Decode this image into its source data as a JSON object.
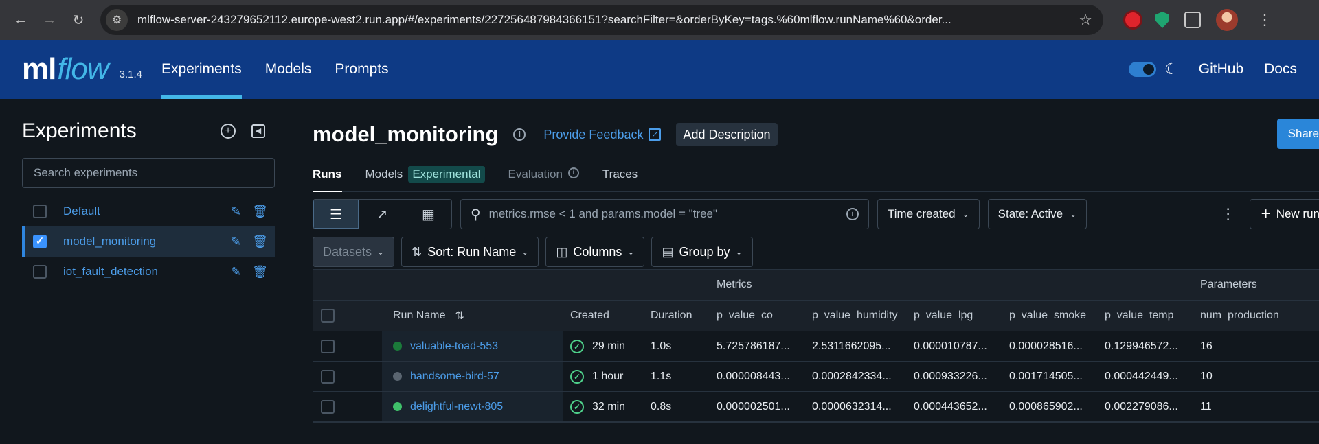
{
  "browser": {
    "url": "mlflow-server-243279652112.europe-west2.run.app/#/experiments/227256487984366151?searchFilter=&orderByKey=tags.%60mlflow.runName%60&order..."
  },
  "header": {
    "logo_ml": "ml",
    "logo_flow": "flow",
    "version": "3.1.4",
    "nav": [
      "Experiments",
      "Models",
      "Prompts"
    ],
    "links": [
      "GitHub",
      "Docs"
    ],
    "accent": "#43b7e8",
    "bg": "#0e3a85"
  },
  "sidebar": {
    "title": "Experiments",
    "search_placeholder": "Search experiments",
    "items": [
      {
        "name": "Default",
        "selected": false
      },
      {
        "name": "model_monitoring",
        "selected": true
      },
      {
        "name": "iot_fault_detection",
        "selected": false
      }
    ]
  },
  "main": {
    "title": "model_monitoring",
    "feedback": "Provide Feedback",
    "add_description": "Add Description",
    "share": "Share",
    "tabs": [
      {
        "label": "Runs"
      },
      {
        "label": "Models",
        "badge": "Experimental"
      },
      {
        "label": "Evaluation"
      },
      {
        "label": "Traces"
      }
    ],
    "filter_placeholder": "metrics.rmse < 1 and params.model = \"tree\"",
    "time_created": "Time created",
    "state": "State: Active",
    "new_run": "New run",
    "datasets": "Datasets",
    "sort": "Sort: Run Name",
    "columns": "Columns",
    "group_by": "Group by"
  },
  "table": {
    "group_headers": {
      "metrics": "Metrics",
      "parameters": "Parameters"
    },
    "columns": [
      "Run Name",
      "Created",
      "Duration",
      "p_value_co",
      "p_value_humidity",
      "p_value_lpg",
      "p_value_smoke",
      "p_value_temp",
      "num_production_"
    ],
    "rows": [
      {
        "name": "valuable-toad-553",
        "dot": "#1b7a3a",
        "created": "29 min",
        "duration": "1.0s",
        "m1": "5.725786187...",
        "m2": "2.5311662095...",
        "m3": "0.000010787...",
        "m4": "0.000028516...",
        "m5": "0.129946572...",
        "p1": "16"
      },
      {
        "name": "handsome-bird-57",
        "dot": "#5a6570",
        "created": "1 hour",
        "duration": "1.1s",
        "m1": "0.000008443...",
        "m2": "0.0002842334...",
        "m3": "0.000933226...",
        "m4": "0.001714505...",
        "m5": "0.000442449...",
        "p1": "10"
      },
      {
        "name": "delightful-newt-805",
        "dot": "#3fc06a",
        "created": "32 min",
        "duration": "0.8s",
        "m1": "0.000002501...",
        "m2": "0.0000632314...",
        "m3": "0.000443652...",
        "m4": "0.000865902...",
        "m5": "0.002279086...",
        "p1": "11"
      }
    ]
  }
}
